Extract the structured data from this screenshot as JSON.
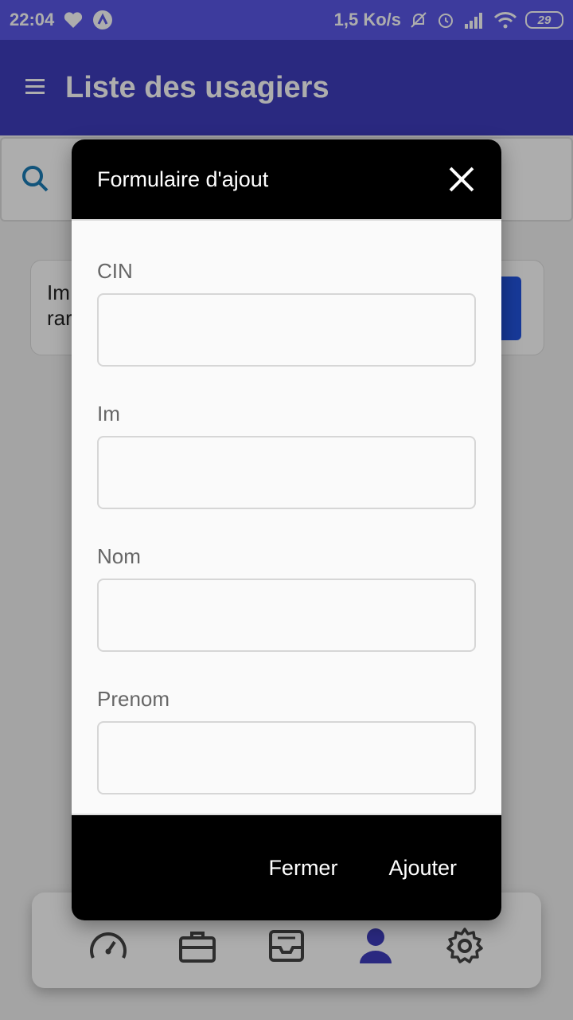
{
  "status_bar": {
    "time": "22:04",
    "network_speed": "1,5 Ko/s",
    "battery": "29",
    "icons": [
      "heart-icon",
      "app-logo-icon",
      "bell-off-icon",
      "alarm-icon",
      "signal-icon",
      "wifi-icon",
      "battery-icon"
    ]
  },
  "app_bar": {
    "title": "Liste des usagiers",
    "menu_icon": "hamburger-menu-icon"
  },
  "background": {
    "list_card_text_line1": "Im",
    "list_card_text_line2": "rar"
  },
  "modal": {
    "title": "Formulaire d'ajout",
    "fields": [
      {
        "label": "CIN",
        "value": ""
      },
      {
        "label": "Im",
        "value": ""
      },
      {
        "label": "Nom",
        "value": ""
      },
      {
        "label": "Prenom",
        "value": ""
      }
    ],
    "close_label": "Fermer",
    "submit_label": "Ajouter"
  },
  "bottom_nav": {
    "items": [
      "dashboard-icon",
      "briefcase-icon",
      "inbox-icon",
      "user-icon",
      "settings-icon"
    ],
    "active": "user-icon",
    "active_color": "#3f3dbd"
  }
}
